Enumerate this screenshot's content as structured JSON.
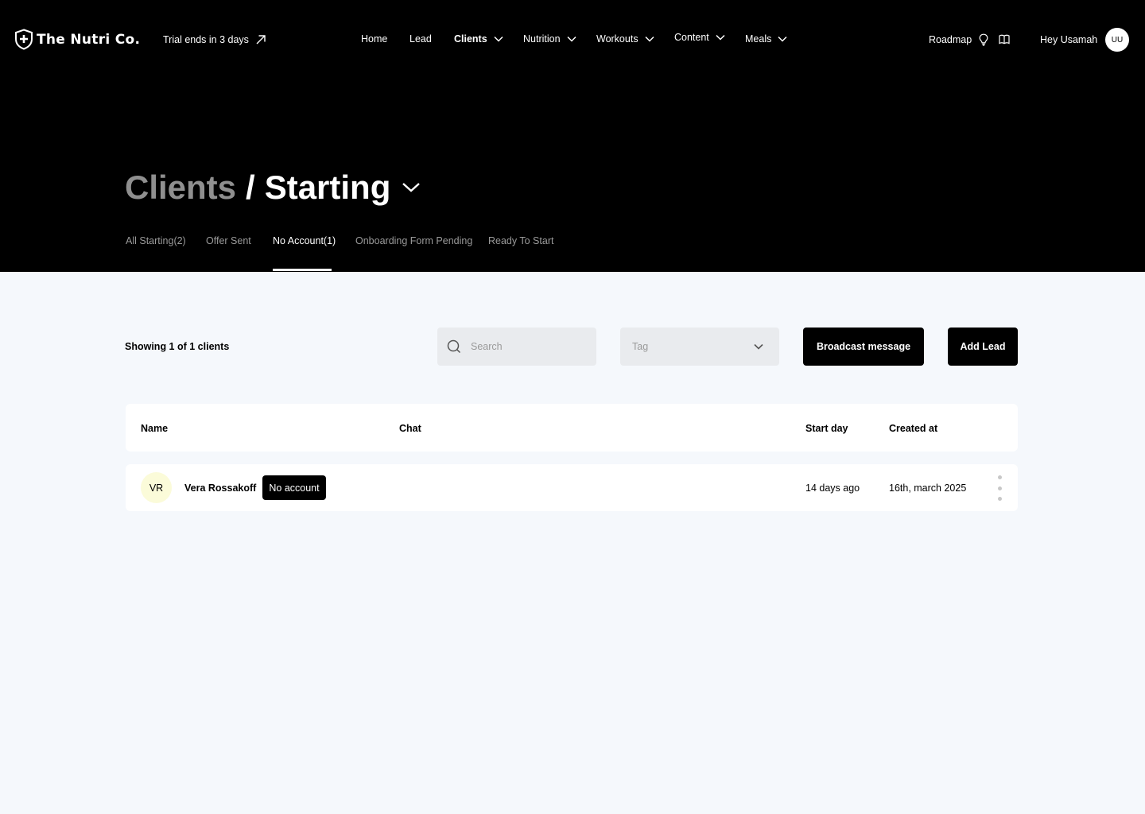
{
  "brand": {
    "name": "The Nutri Co."
  },
  "trial": {
    "label": "Trial ends in 3 days"
  },
  "nav": {
    "items": [
      {
        "label": "Home",
        "dropdown": false,
        "active": false
      },
      {
        "label": "Lead",
        "dropdown": false,
        "active": false
      },
      {
        "label": "Clients",
        "dropdown": true,
        "active": true
      },
      {
        "label": "Nutrition",
        "dropdown": true,
        "active": false
      },
      {
        "label": "Workouts",
        "dropdown": true,
        "active": false
      },
      {
        "label": "Content",
        "dropdown": true,
        "active": false
      },
      {
        "label": "Meals",
        "dropdown": true,
        "active": false
      }
    ]
  },
  "header_right": {
    "roadmap_label": "Roadmap",
    "greeting": "Hey Usamah",
    "avatar_initials": "UU",
    "icons": [
      "lightbulb-icon",
      "book-icon"
    ]
  },
  "page": {
    "breadcrumb_parent": "Clients",
    "breadcrumb_separator": "/",
    "title": "Starting"
  },
  "tabs": [
    {
      "label": "All Starting(2)",
      "active": false
    },
    {
      "label": "Offer Sent",
      "active": false
    },
    {
      "label": "No Account(1)",
      "active": true
    },
    {
      "label": "Onboarding Form Pending",
      "active": false
    },
    {
      "label": "Ready To Start",
      "active": false
    }
  ],
  "toolbar": {
    "showing_text": "Showing 1 of 1 clients",
    "search_placeholder": "Search",
    "search_value": "",
    "tag_placeholder": "Tag",
    "broadcast_label": "Broadcast message",
    "add_lead_label": "Add Lead"
  },
  "table": {
    "columns": [
      "Name",
      "Chat",
      "Start day",
      "Created at"
    ],
    "rows": [
      {
        "initials": "VR",
        "name": "Vera Rossakoff",
        "badge": "No account",
        "chat": "",
        "start_day": "14 days ago",
        "created_at": "16th, march 2025"
      }
    ]
  },
  "colors": {
    "header_bg": "#000000",
    "page_bg": "#f5f8fc",
    "input_bg": "#e9ebee",
    "muted_text": "#9a9a9a",
    "breadcrumb_parent": "#8f8f8f",
    "avatar_row_bg": "#fbfbd9",
    "button_bg": "#000000"
  }
}
